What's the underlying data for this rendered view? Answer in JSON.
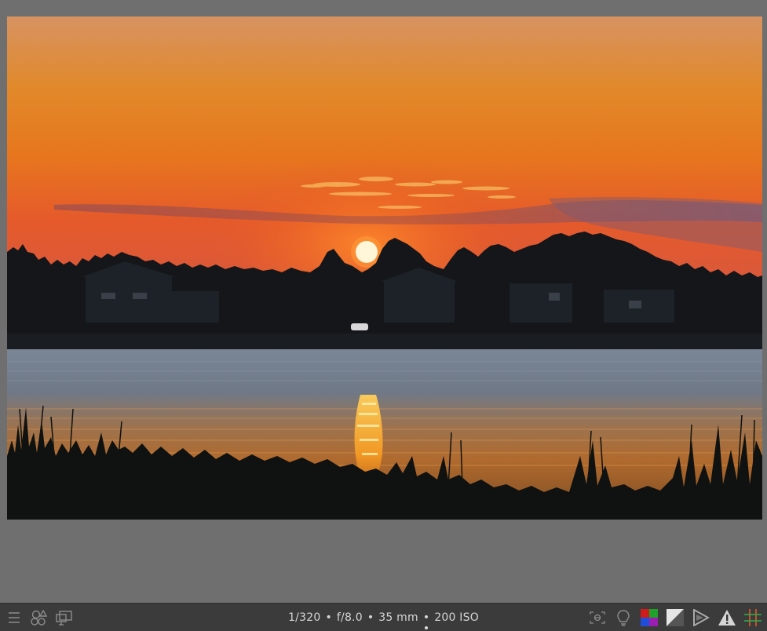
{
  "photo": {
    "subject": "",
    "colors": {
      "sky_top": "#d9905a",
      "sky_mid": "#e8871c",
      "sky_low": "#e8552a",
      "sun": "#fff6d8",
      "water": "#6c7a8c",
      "reflection": "#f59a23",
      "silhouette": "#101315"
    }
  },
  "exif": {
    "shutter": "1/320",
    "aperture": "f/8.0",
    "focal_length": "35 mm",
    "iso": "200 ISO",
    "separator": "•"
  },
  "toolbar_left": [
    {
      "name": "menu-icon"
    },
    {
      "name": "styles-icon"
    },
    {
      "name": "display-icon"
    }
  ],
  "toolbar_right": [
    {
      "name": "focus-peaking-icon"
    },
    {
      "name": "bulb-icon"
    },
    {
      "name": "color-assessment-icon",
      "colors": [
        "#d11a1a",
        "#1fa12a",
        "#1f4fd8",
        "#9a1fb0"
      ]
    },
    {
      "name": "softproof-icon"
    },
    {
      "name": "gamut-check-icon"
    },
    {
      "name": "overexposure-warning-icon"
    },
    {
      "name": "guides-icon",
      "colors": [
        "#e05a2a",
        "#2fb04a"
      ]
    }
  ]
}
